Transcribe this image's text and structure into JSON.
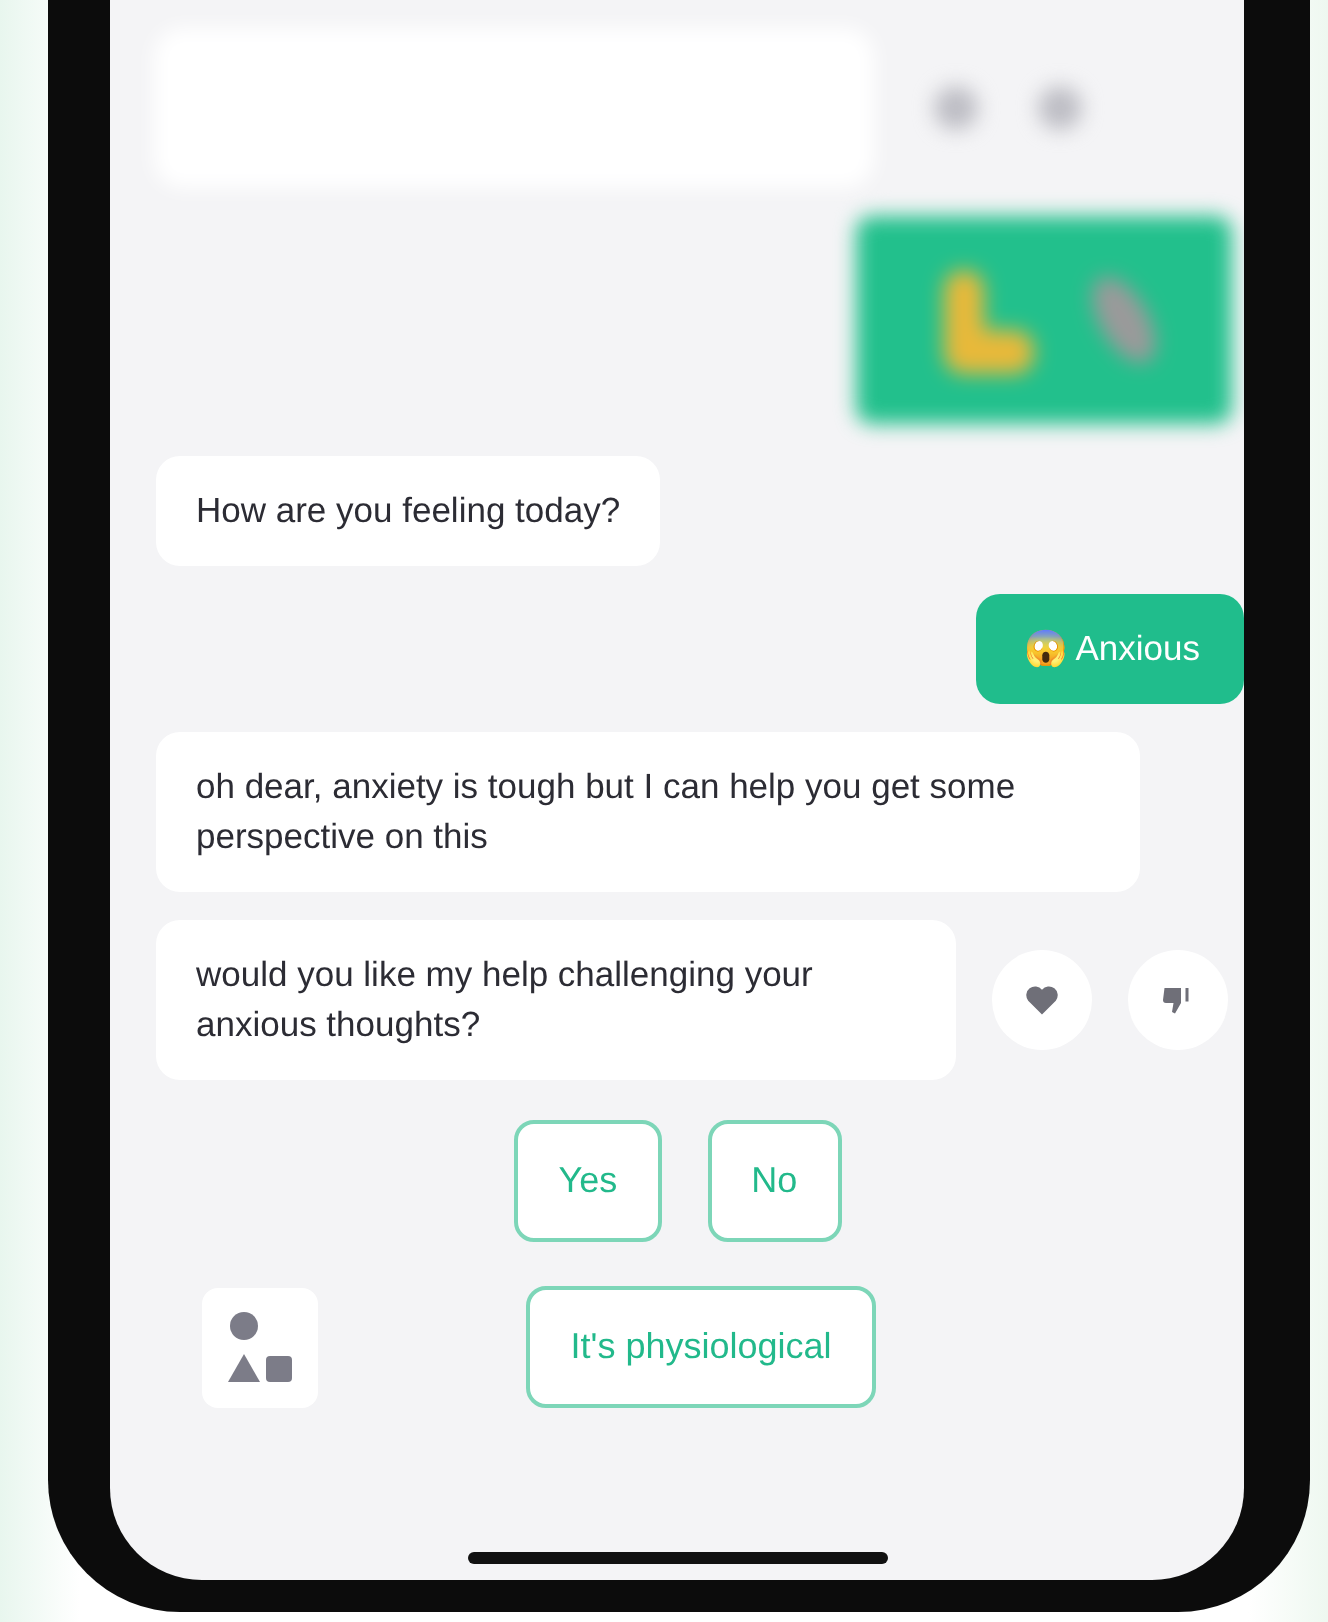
{
  "messages": [
    {
      "kind": "bot",
      "text": "How are you feeling today?"
    },
    {
      "kind": "user",
      "text": "😱 Anxious"
    },
    {
      "kind": "bot",
      "text": "oh dear, anxiety is tough but I can help you get some perspective on this"
    },
    {
      "kind": "bot",
      "text": "would you like my help challenging your anxious thoughts?",
      "reactions": true
    }
  ],
  "replies": [
    [
      "Yes",
      "No"
    ],
    [
      "It's physiological"
    ]
  ]
}
